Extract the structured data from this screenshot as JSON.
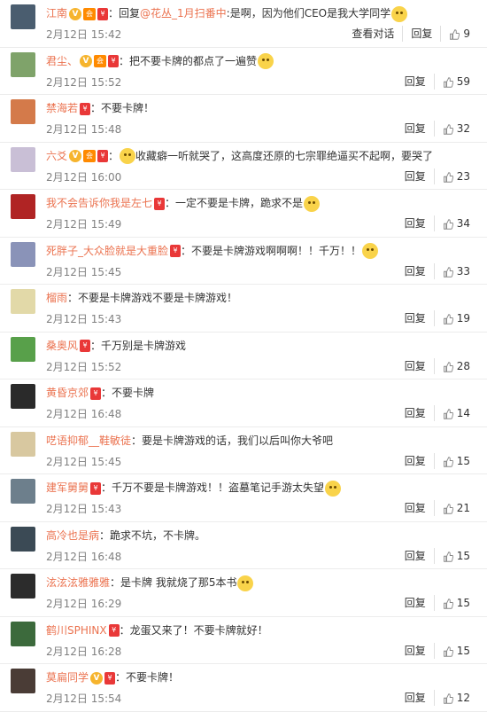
{
  "comments": [
    {
      "user": "江南",
      "badges": [
        "v",
        "vip",
        "red"
      ],
      "content_parts": [
        {
          "t": "：回复"
        },
        {
          "t": "@花丛_1月扫番中",
          "link": true
        },
        {
          "t": ":是啊，因为他们CEO是我大学同学"
        }
      ],
      "emoji": true,
      "time": "2月12日 15:42",
      "extra": "查看对话",
      "reply": "回复",
      "likes": "9",
      "avatar": "#4a5d6f"
    },
    {
      "user": "君尘、",
      "badges": [
        "v",
        "vip",
        "red"
      ],
      "content_parts": [
        {
          "t": "：把不要卡牌的都点了一遍赞"
        }
      ],
      "emoji": true,
      "time": "2月12日 15:52",
      "reply": "回复",
      "likes": "59",
      "avatar": "#7fa36a"
    },
    {
      "user": "禁海若",
      "badges": [
        "red"
      ],
      "content_parts": [
        {
          "t": "：不要卡牌！"
        }
      ],
      "emoji": false,
      "time": "2月12日 15:48",
      "reply": "回复",
      "likes": "32",
      "avatar": "#d47a4a"
    },
    {
      "user": "六爻",
      "badges": [
        "v",
        "vip",
        "red"
      ],
      "content_parts": [
        {
          "t": "收藏癖一听就哭了，这高度还原的七宗罪绝逼买不起啊，要哭了"
        }
      ],
      "emoji": true,
      "emoji_first": true,
      "time": "2月12日 16:00",
      "reply": "回复",
      "likes": "23",
      "avatar": "#c9bfd6"
    },
    {
      "user": "我不会告诉你我是左七",
      "badges": [
        "red"
      ],
      "content_parts": [
        {
          "t": "：一定不要是卡牌，跪求不是"
        }
      ],
      "emoji": true,
      "time": "2月12日 15:49",
      "reply": "回复",
      "likes": "34",
      "avatar": "#b02424"
    },
    {
      "user": "死胖子_大众脸就是大重脸",
      "badges": [
        "red"
      ],
      "content_parts": [
        {
          "t": "：不要是卡牌游戏啊啊啊！！千万！！"
        }
      ],
      "emoji": true,
      "time": "2月12日 15:45",
      "reply": "回复",
      "likes": "33",
      "avatar": "#8a93b8"
    },
    {
      "user": "榴雨",
      "badges": [],
      "content_parts": [
        {
          "t": "：不要是卡牌游戏不要是卡牌游戏！"
        }
      ],
      "emoji": false,
      "time": "2月12日 15:43",
      "reply": "回复",
      "likes": "19",
      "avatar": "#e2d9a8"
    },
    {
      "user": "桑奥风",
      "badges": [
        "red"
      ],
      "content_parts": [
        {
          "t": "：千万别是卡牌游戏"
        }
      ],
      "emoji": false,
      "time": "2月12日 15:52",
      "reply": "回复",
      "likes": "28",
      "avatar": "#58a04a"
    },
    {
      "user": "黄昏京郊",
      "badges": [
        "red"
      ],
      "content_parts": [
        {
          "t": "：不要卡牌"
        }
      ],
      "emoji": false,
      "time": "2月12日 16:48",
      "reply": "回复",
      "likes": "14",
      "avatar": "#2a2a2a"
    },
    {
      "user": "呓语抑郁__鞋敏徒",
      "badges": [],
      "content_parts": [
        {
          "t": "：要是卡牌游戏的话，我们以后叫你大爷吧"
        }
      ],
      "emoji": false,
      "time": "2月12日 15:45",
      "reply": "回复",
      "likes": "15",
      "avatar": "#d8c8a0"
    },
    {
      "user": "建军舅舅",
      "badges": [
        "red"
      ],
      "content_parts": [
        {
          "t": "：千万不要是卡牌游戏！！盗墓笔记手游太失望"
        }
      ],
      "emoji": true,
      "time": "2月12日 15:43",
      "reply": "回复",
      "likes": "21",
      "avatar": "#6d7f8c"
    },
    {
      "user": "高冷也是病",
      "badges": [],
      "content_parts": [
        {
          "t": "：跪求不坑，不卡牌。"
        }
      ],
      "emoji": false,
      "time": "2月12日 16:48",
      "reply": "回复",
      "likes": "15",
      "avatar": "#3b4a55"
    },
    {
      "user": "泫泫泫雅雅雅",
      "badges": [],
      "content_parts": [
        {
          "t": "：是卡牌 我就烧了那5本书"
        }
      ],
      "emoji": true,
      "time": "2月12日 16:29",
      "reply": "回复",
      "likes": "15",
      "avatar": "#2c2c2c"
    },
    {
      "user": "鹤川SPHINX",
      "badges": [
        "red"
      ],
      "content_parts": [
        {
          "t": "：龙蛋又来了！不要卡牌就好！"
        }
      ],
      "emoji": false,
      "time": "2月12日 16:28",
      "reply": "回复",
      "likes": "15",
      "avatar": "#3c6a3c"
    },
    {
      "user": "莫扁同学",
      "badges": [
        "v",
        "red"
      ],
      "content_parts": [
        {
          "t": "：不要卡牌！"
        }
      ],
      "emoji": false,
      "time": "2月12日 15:54",
      "reply": "回复",
      "likes": "12",
      "avatar": "#4a3c36"
    }
  ]
}
